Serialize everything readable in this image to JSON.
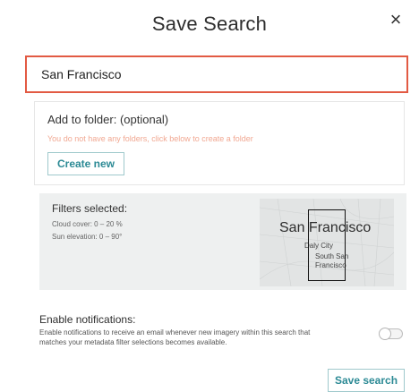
{
  "dialog": {
    "title": "Save Search",
    "close_glyph": "×",
    "close_icon": "close-icon"
  },
  "name_input": {
    "value": "San Francisco",
    "border_color": "#e25a43"
  },
  "folder": {
    "label": "Add to folder: (optional)",
    "hint": "You do not have any folders, click below to create a folder",
    "create_label": "Create new"
  },
  "filters": {
    "title": "Filters selected:",
    "cloud_cover": "Cloud cover: 0 – 20 %",
    "sun_elevation": "Sun elevation: 0 – 90°",
    "map": {
      "city_label": "San Francisco",
      "daly_city_label": "Daly City",
      "south_sf_label": "South San Francisco"
    }
  },
  "notifications": {
    "title": "Enable notifications:",
    "description": "Enable notifications to receive an email whenever new imagery within this search that matches your metadata filter selections becomes available.",
    "enabled": false
  },
  "actions": {
    "save_label": "Save search"
  },
  "colors": {
    "accent": "#2c8a95",
    "accent_border": "#9fc9cc",
    "hint_text": "#f1a892",
    "filters_bg": "#eef0f0"
  }
}
